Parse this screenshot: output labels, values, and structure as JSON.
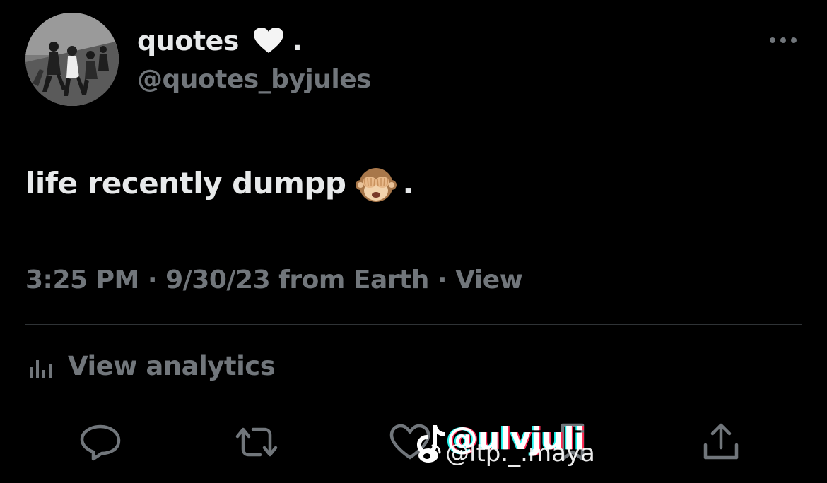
{
  "tweet": {
    "author": {
      "display_name": "quotes",
      "name_suffix": ".",
      "heart_emoji": "white-heart",
      "handle": "@quotes_byjules"
    },
    "text": "life recently dumpp",
    "text_emoji": "see-no-evil-monkey",
    "text_suffix": ".",
    "meta": {
      "time": "3:25 PM",
      "separator": "·",
      "date": "9/30/23",
      "source": "from Earth",
      "view_label": "View"
    },
    "analytics": {
      "label": "View analytics"
    },
    "actions": [
      {
        "name": "reply",
        "icon": "reply-icon"
      },
      {
        "name": "retweet",
        "icon": "retweet-icon"
      },
      {
        "name": "like",
        "icon": "heart-icon"
      },
      {
        "name": "bookmark",
        "icon": "bookmark-icon"
      },
      {
        "name": "share",
        "icon": "share-icon"
      }
    ]
  },
  "watermark": {
    "tiktok_text": "@ulvjuli",
    "weibo_text": "@ltp._.maya"
  },
  "colors": {
    "background": "#000000",
    "primary_text": "#e7e9ea",
    "secondary_text": "#71767b",
    "divider": "#2f3336"
  }
}
